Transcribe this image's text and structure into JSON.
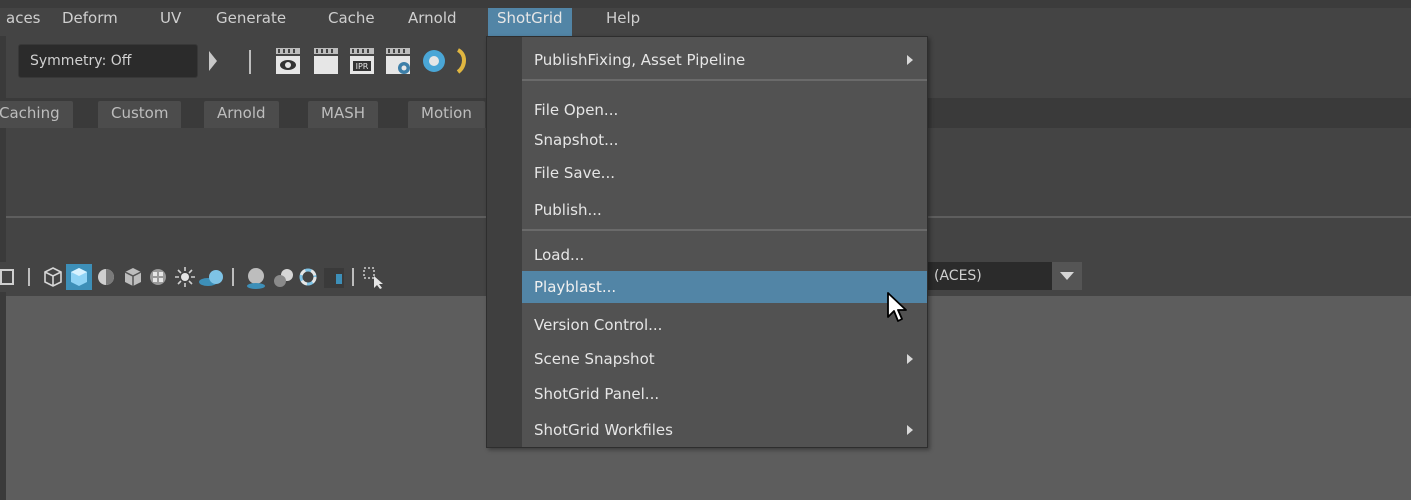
{
  "menubar": {
    "items": [
      "aces",
      "Deform",
      "UV",
      "Generate",
      "Cache",
      "Arnold",
      "ShotGrid",
      "Help"
    ],
    "active": "ShotGrid"
  },
  "statusline": {
    "symmetry_label": "Symmetry: Off",
    "icons": [
      "show-hide-icon",
      "render-current-frame-icon",
      "ipr-render-icon",
      "render-settings-icon",
      "hypershade-icon"
    ]
  },
  "shelf": {
    "tabs": [
      "Caching",
      "Custom",
      "Arnold",
      "MASH",
      "Motion"
    ]
  },
  "viewport_toolbar": {
    "color_space_value": "(ACES)",
    "icons": [
      "panel-layout-icon",
      "wireframe-icon",
      "smooth-shade-icon",
      "xray-icon",
      "textured-icon",
      "checker-icon",
      "lights-icon",
      "shadows-icon",
      "ambient-occlusion-icon",
      "motion-blur-icon",
      "antialiasing-icon",
      "isolate-select-icon",
      "select-icon"
    ]
  },
  "shotgrid_menu": {
    "items": [
      {
        "label": "PublishFixing, Asset Pipeline",
        "submenu": true
      },
      {
        "label": "File Open...",
        "submenu": false
      },
      {
        "label": "Snapshot...",
        "submenu": false
      },
      {
        "label": "File Save...",
        "submenu": false
      },
      {
        "label": "Publish...",
        "submenu": false
      },
      {
        "label": "Load...",
        "submenu": false
      },
      {
        "label": "Playblast...",
        "submenu": false,
        "highlighted": true
      },
      {
        "label": "Version Control...",
        "submenu": false
      },
      {
        "label": "Scene Snapshot",
        "submenu": true
      },
      {
        "label": "ShotGrid Panel...",
        "submenu": false
      },
      {
        "label": "ShotGrid Workfiles",
        "submenu": true
      }
    ]
  },
  "colors": {
    "accent": "#5285a6",
    "menu_bg": "#525252",
    "app_bg": "#444444",
    "viewport_bg": "#5d5d5d",
    "text": "#e6e6e6"
  }
}
